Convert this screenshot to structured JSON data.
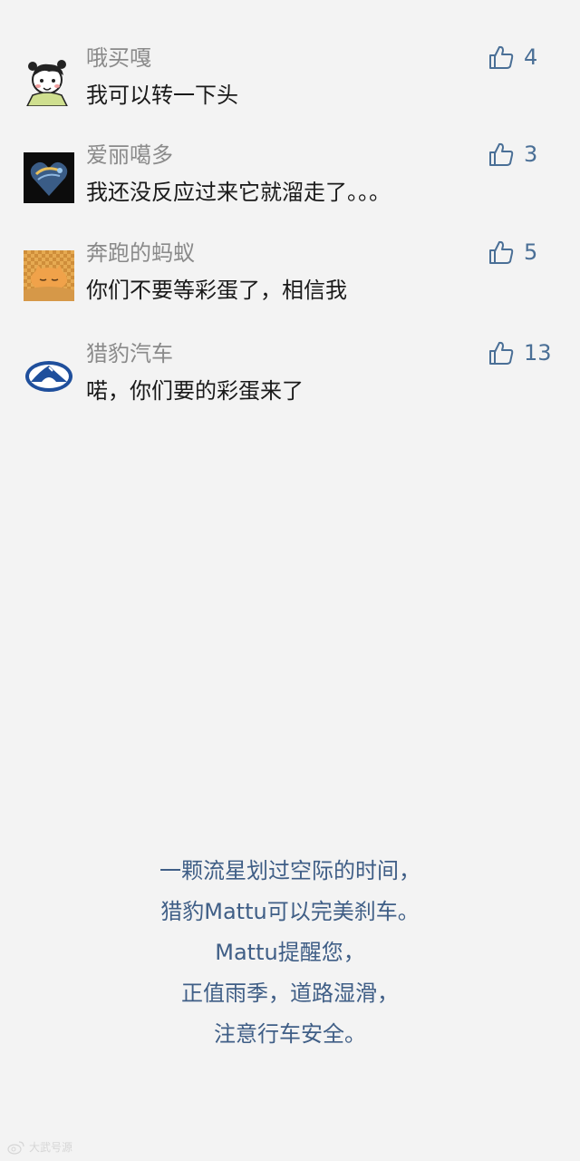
{
  "comments": [
    {
      "username": "哦买嘎",
      "text": "我可以转一下头",
      "likes": "4",
      "avatar_icon": "girl-cartoon-avatar"
    },
    {
      "username": "爱丽噶多",
      "text": "我还没反应过来它就溜走了。。。",
      "likes": "3",
      "avatar_icon": "heart-photo-avatar"
    },
    {
      "username": "奔跑的蚂蚁",
      "text": "你们不要等彩蛋了，相信我",
      "likes": "5",
      "avatar_icon": "cat-photo-avatar"
    },
    {
      "username": "猎豹汽车",
      "text": "喏，你们要的彩蛋来了",
      "likes": "13",
      "avatar_icon": "leopard-logo-avatar"
    }
  ],
  "slogan": {
    "lines": [
      "一颗流星划过空际的时间，",
      "猎豹Mattu可以完美刹车。",
      "Mattu提醒您，",
      "正值雨季，道路湿滑，",
      "注意行车安全。"
    ]
  },
  "watermark": {
    "text": "大武号源",
    "icon": "weibo-icon"
  },
  "colors": {
    "background": "#f3f3f3",
    "username": "#8a8a8a",
    "comment_text": "#1a1a1a",
    "like_accent": "#4a6f96",
    "slogan": "#3f5e86"
  }
}
